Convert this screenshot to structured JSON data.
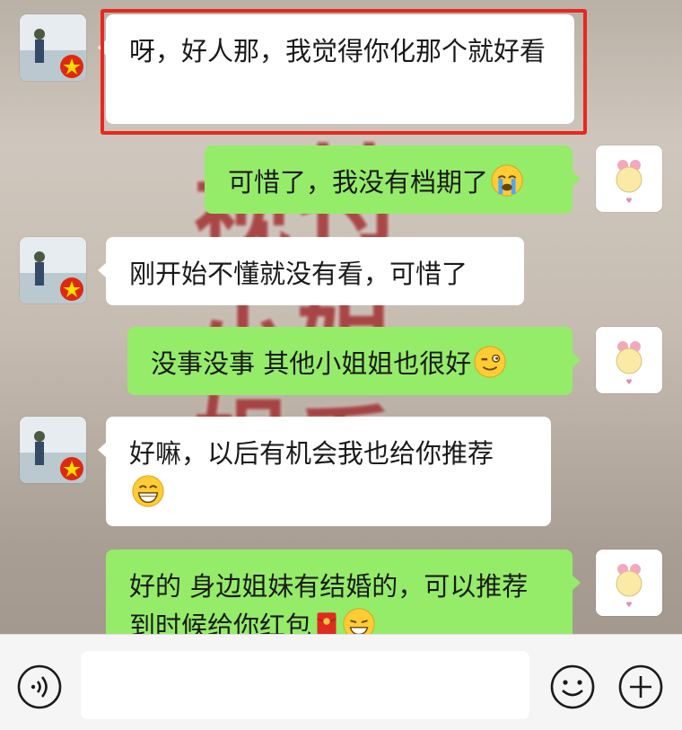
{
  "messages": [
    {
      "side": "in",
      "text": "呀，好人那，我觉得你化那个就好看",
      "emoji": "",
      "highlighted": true
    },
    {
      "side": "out",
      "text": "可惜了，我没有档期了",
      "emoji": "crying-face-icon"
    },
    {
      "side": "in",
      "text": "刚开始不懂就没有看，可惜了",
      "emoji": ""
    },
    {
      "side": "out",
      "text": "没事没事  其他小姐姐也很好",
      "emoji": "winking-face-icon"
    },
    {
      "side": "in",
      "text": "好嘛，以后有机会我也给你推荐",
      "emoji": "grinning-face-icon"
    },
    {
      "side": "out",
      "text": "好的  身边姐妹有结婚的，可以推荐  到时候给你红包",
      "emoji": "red-envelope-icon"
    }
  ],
  "input_bar": {
    "voice_icon": "voice-icon",
    "input_value": "",
    "emoji_icon": "emoji-icon",
    "add_icon": "add-icon"
  },
  "colors": {
    "outgoing_bubble": "#95ec69",
    "incoming_bubble": "#ffffff",
    "highlight_border": "#e8281f"
  }
}
